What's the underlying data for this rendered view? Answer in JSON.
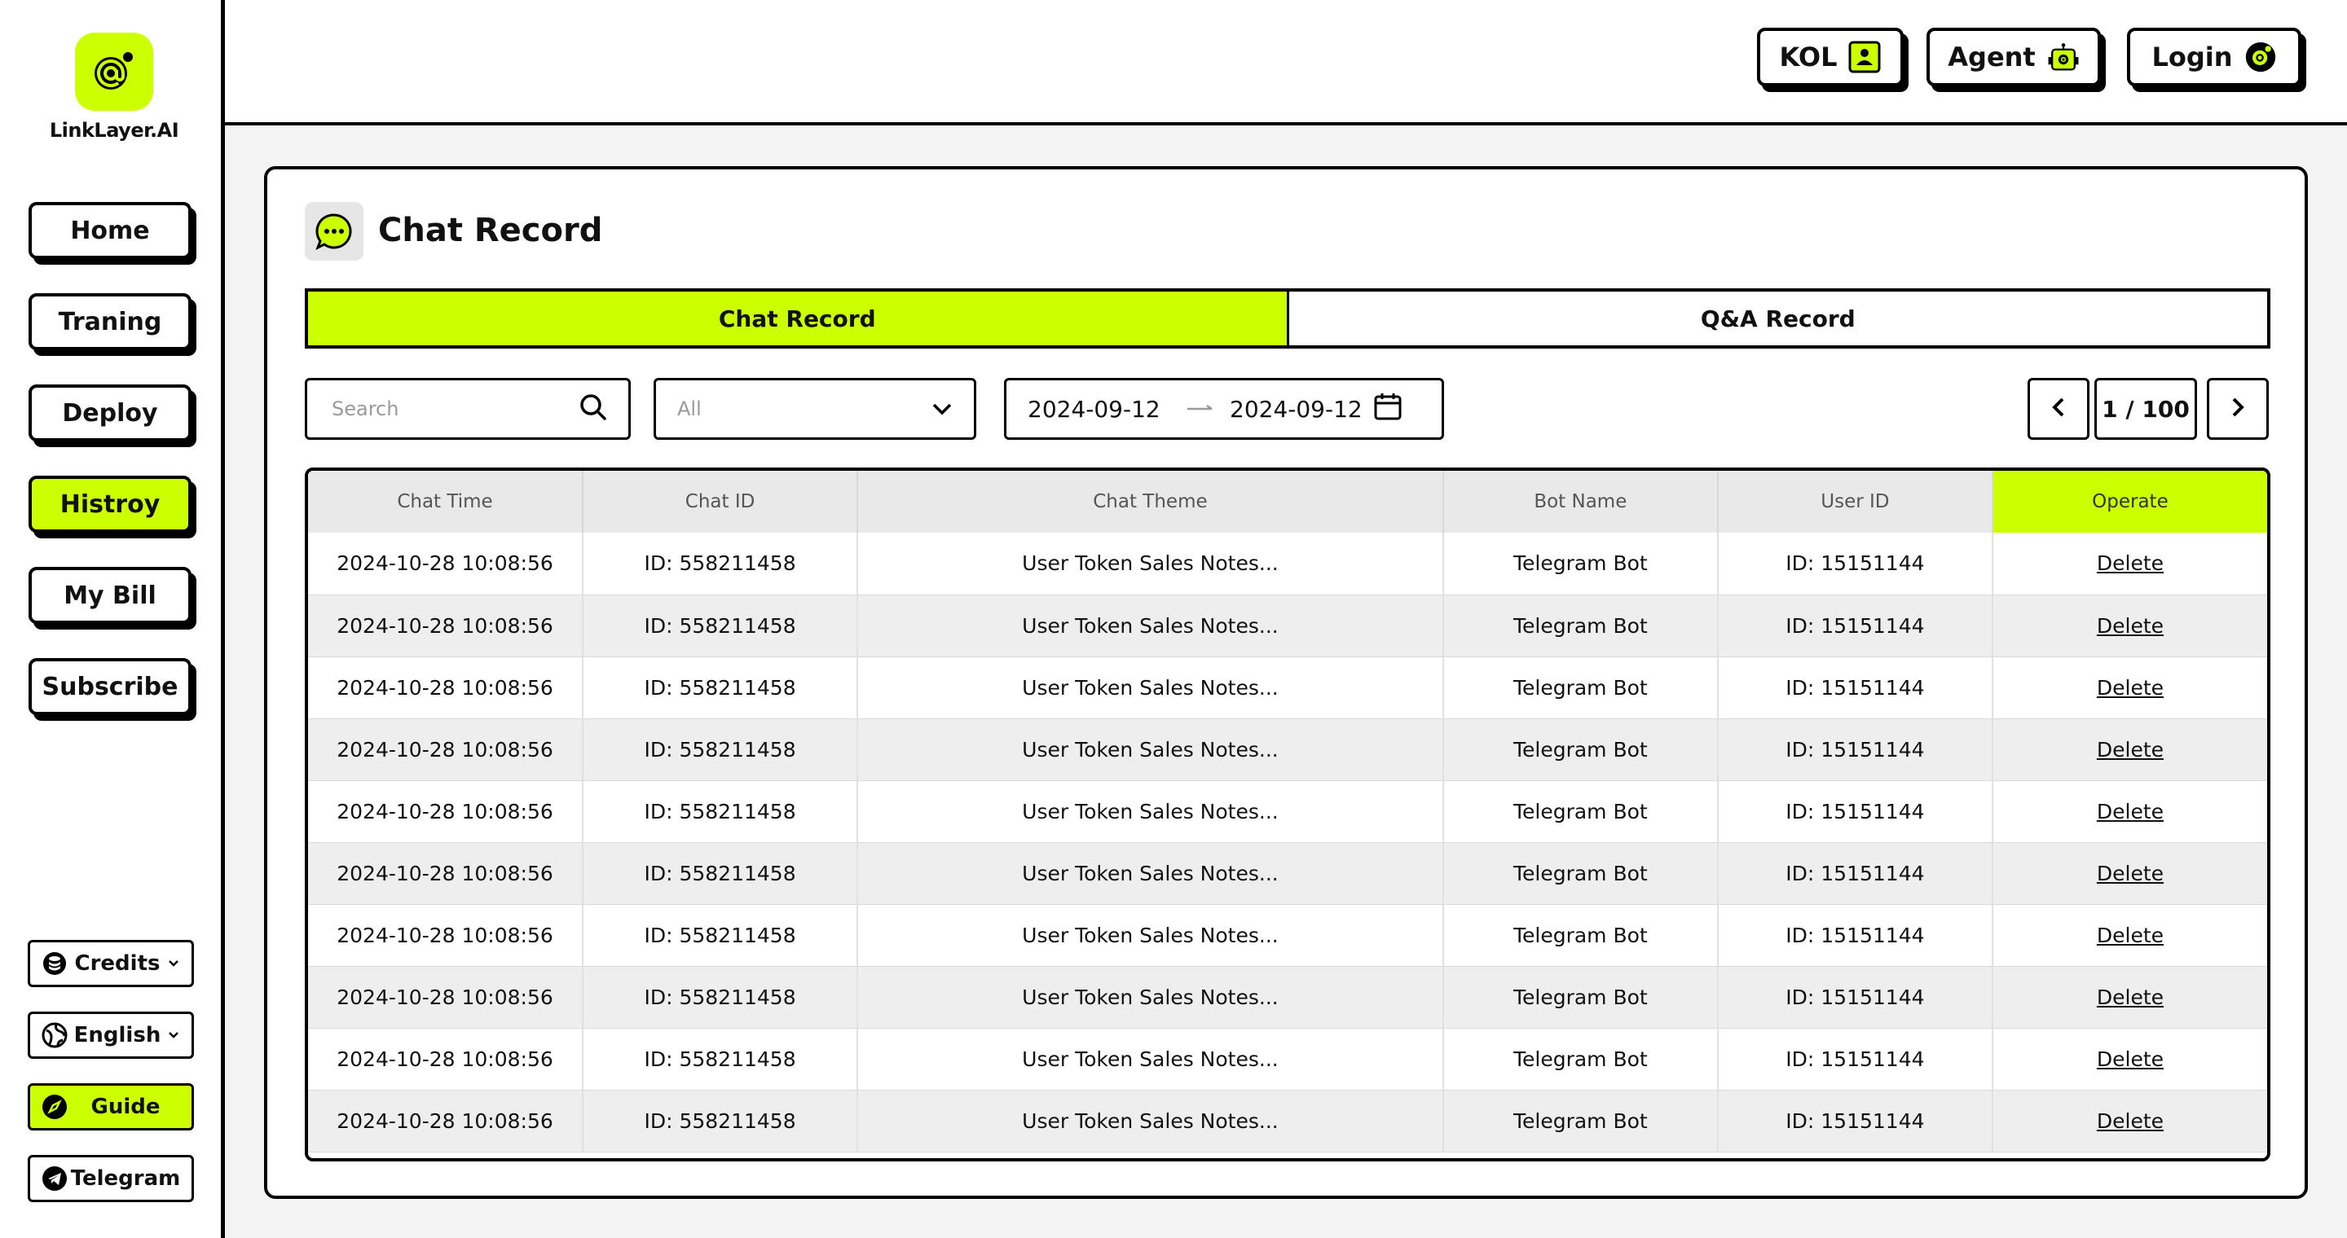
{
  "brand": {
    "name": "LinkLayer.AI"
  },
  "nav": [
    {
      "label": "Home",
      "active": false
    },
    {
      "label": "Traning",
      "active": false
    },
    {
      "label": "Deploy",
      "active": false
    },
    {
      "label": "Histroy",
      "active": true
    },
    {
      "label": "My Bill",
      "active": false
    },
    {
      "label": "Subscribe",
      "active": false
    }
  ],
  "utilities": {
    "credits": {
      "label": "Credits",
      "icon": "database-icon"
    },
    "language": {
      "label": "English",
      "icon": "globe-icon"
    },
    "guide": {
      "label": "Guide",
      "icon": "compass-icon"
    },
    "telegram": {
      "label": "Telegram",
      "icon": "telegram-icon"
    }
  },
  "header": {
    "kol_label": "KOL",
    "agent_label": "Agent",
    "login_label": "Login"
  },
  "page": {
    "title": "Chat Record",
    "tabs": [
      {
        "label": "Chat Record",
        "active": true
      },
      {
        "label": "Q&A Record",
        "active": false
      }
    ]
  },
  "filters": {
    "search_placeholder": "Search",
    "select_value": "All",
    "date_start": "2024-09-12",
    "date_end": "2024-09-12"
  },
  "pager": {
    "label": "1 / 100"
  },
  "table": {
    "columns": [
      "Chat Time",
      "Chat ID",
      "Chat Theme",
      "Bot Name",
      "User ID",
      "Operate"
    ],
    "rows": [
      {
        "time": "2024-10-28 10:08:56",
        "chat_id": "ID: 558211458",
        "theme": "User Token Sales Notes...",
        "bot": "Telegram Bot",
        "user_id": "ID: 15151144",
        "action": "Delete"
      },
      {
        "time": "2024-10-28 10:08:56",
        "chat_id": "ID: 558211458",
        "theme": "User Token Sales Notes...",
        "bot": "Telegram Bot",
        "user_id": "ID: 15151144",
        "action": "Delete"
      },
      {
        "time": "2024-10-28 10:08:56",
        "chat_id": "ID: 558211458",
        "theme": "User Token Sales Notes...",
        "bot": "Telegram Bot",
        "user_id": "ID: 15151144",
        "action": "Delete"
      },
      {
        "time": "2024-10-28 10:08:56",
        "chat_id": "ID: 558211458",
        "theme": "User Token Sales Notes...",
        "bot": "Telegram Bot",
        "user_id": "ID: 15151144",
        "action": "Delete"
      },
      {
        "time": "2024-10-28 10:08:56",
        "chat_id": "ID: 558211458",
        "theme": "User Token Sales Notes...",
        "bot": "Telegram Bot",
        "user_id": "ID: 15151144",
        "action": "Delete"
      },
      {
        "time": "2024-10-28 10:08:56",
        "chat_id": "ID: 558211458",
        "theme": "User Token Sales Notes...",
        "bot": "Telegram Bot",
        "user_id": "ID: 15151144",
        "action": "Delete"
      },
      {
        "time": "2024-10-28 10:08:56",
        "chat_id": "ID: 558211458",
        "theme": "User Token Sales Notes...",
        "bot": "Telegram Bot",
        "user_id": "ID: 15151144",
        "action": "Delete"
      },
      {
        "time": "2024-10-28 10:08:56",
        "chat_id": "ID: 558211458",
        "theme": "User Token Sales Notes...",
        "bot": "Telegram Bot",
        "user_id": "ID: 15151144",
        "action": "Delete"
      },
      {
        "time": "2024-10-28 10:08:56",
        "chat_id": "ID: 558211458",
        "theme": "User Token Sales Notes...",
        "bot": "Telegram Bot",
        "user_id": "ID: 15151144",
        "action": "Delete"
      },
      {
        "time": "2024-10-28 10:08:56",
        "chat_id": "ID: 558211458",
        "theme": "User Token Sales Notes...",
        "bot": "Telegram Bot",
        "user_id": "ID: 15151144",
        "action": "Delete"
      }
    ]
  },
  "colors": {
    "accent": "#ccff00",
    "border": "#000000",
    "row_alt": "#eeeeee"
  }
}
